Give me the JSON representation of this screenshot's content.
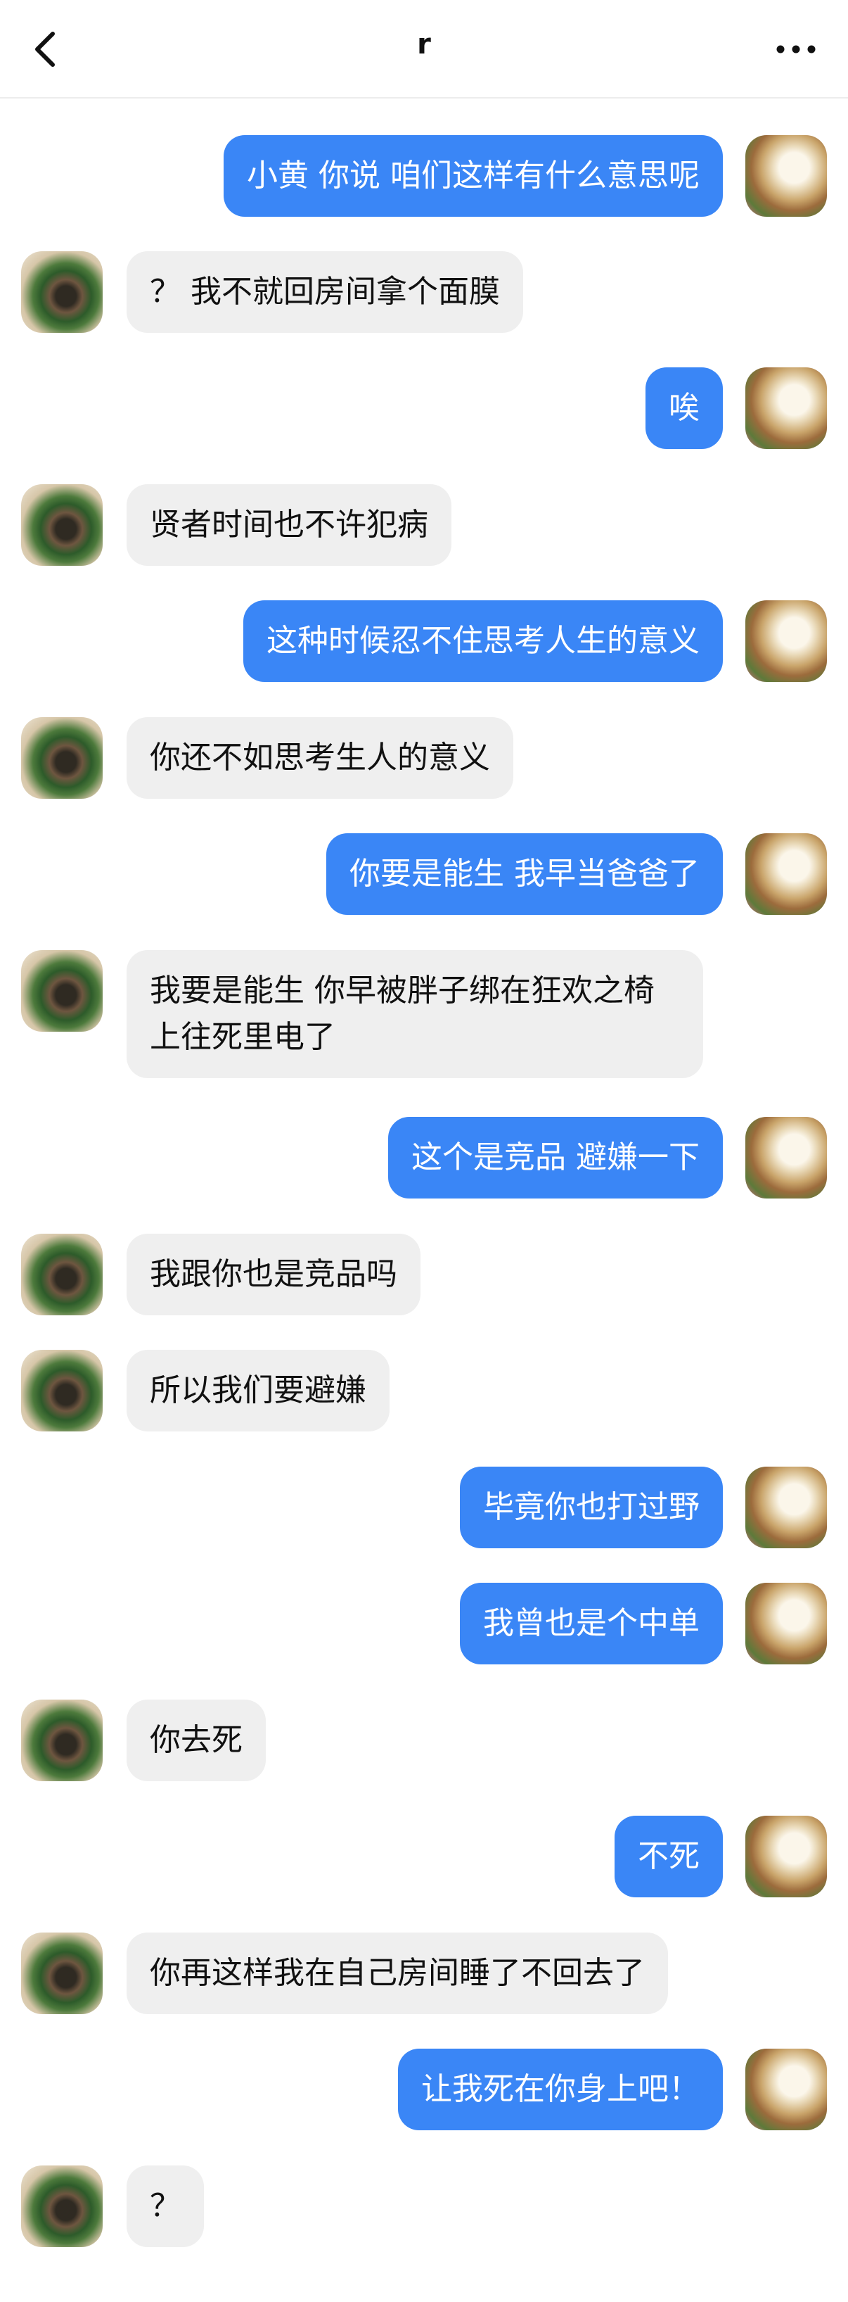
{
  "header": {
    "title": "r",
    "back_icon": "chevron-left-icon",
    "more_icon": "more-horizontal-icon"
  },
  "colors": {
    "sent_bubble": "#3a86f6",
    "received_bubble": "#efefef",
    "sent_text": "#ffffff",
    "received_text": "#111111"
  },
  "messages": [
    {
      "side": "right",
      "text": "小黄 你说 咱们这样有什么意思呢"
    },
    {
      "side": "left",
      "text": "？ 我不就回房间拿个面膜"
    },
    {
      "side": "right",
      "text": "唉"
    },
    {
      "side": "left",
      "text": "贤者时间也不许犯病"
    },
    {
      "side": "right",
      "text": "这种时候忍不住思考人生的意义"
    },
    {
      "side": "left",
      "text": "你还不如思考生人的意义"
    },
    {
      "side": "right",
      "text": "你要是能生 我早当爸爸了"
    },
    {
      "side": "left",
      "text": "我要是能生 你早被胖子绑在狂欢之椅上往死里电了"
    },
    {
      "side": "right",
      "text": "这个是竞品 避嫌一下"
    },
    {
      "side": "left",
      "text": "我跟你也是竞品吗"
    },
    {
      "side": "left",
      "text": "所以我们要避嫌"
    },
    {
      "side": "right",
      "text": "毕竟你也打过野"
    },
    {
      "side": "right",
      "text": "我曾也是个中单"
    },
    {
      "side": "left",
      "text": "你去死"
    },
    {
      "side": "right",
      "text": "不死"
    },
    {
      "side": "left",
      "text": "你再这样我在自己房间睡了不回去了"
    },
    {
      "side": "right",
      "text": "让我死在你身上吧！"
    },
    {
      "side": "left",
      "text": "？"
    }
  ]
}
